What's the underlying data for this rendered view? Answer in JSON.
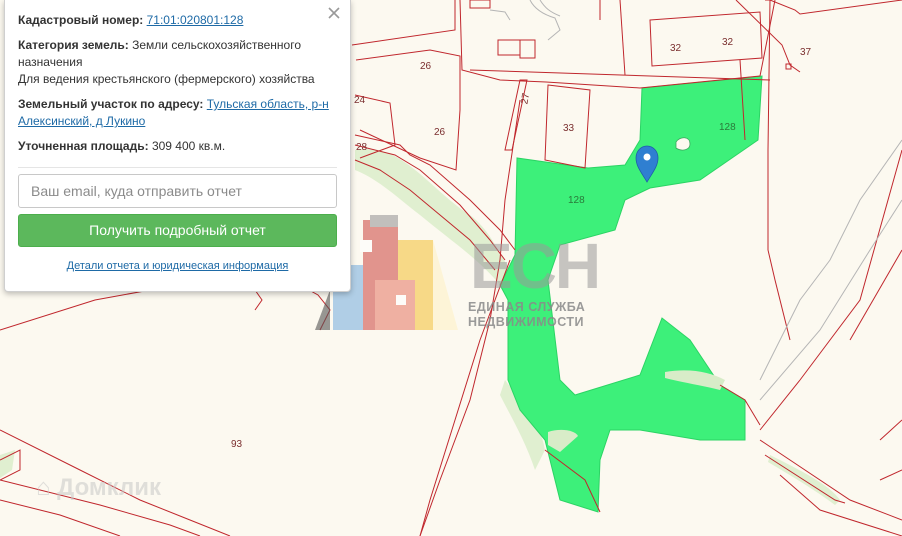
{
  "map": {
    "plot_labels": [
      "32",
      "32",
      "37",
      "26",
      "24",
      "27",
      "33",
      "128",
      "26",
      "28",
      "128",
      "93"
    ],
    "selected_plot_color": "#3df07a",
    "boundary_color": "#c0272d",
    "marker_color": "#2f7fd1"
  },
  "popup": {
    "cadastral_label": "Кадастровый номер:",
    "cadastral_number": "71:01:020801:128",
    "category_label": "Категория земель:",
    "category_value": "Земли сельскохозяйственного назначения",
    "usage_value": "Для ведения крестьянского (фермерского) хозяйства",
    "address_label": "Земельный участок по адресу:",
    "address_value": "Тульская область, р-н Алексинский, д Лукино",
    "area_label": "Уточненная площадь:",
    "area_value": "309 400 кв.м.",
    "email_placeholder": "Ваш email, куда отправить отчет",
    "submit_label": "Получить подробный отчет",
    "details_link": "Детали отчета и юридическая информация"
  },
  "watermarks": {
    "esn_logo": "ЕСН",
    "esn_line1": "ЕДИНАЯ СЛУЖБА",
    "esn_line2": "НЕДВИЖИМОСТИ",
    "domclick": "Домклик"
  }
}
